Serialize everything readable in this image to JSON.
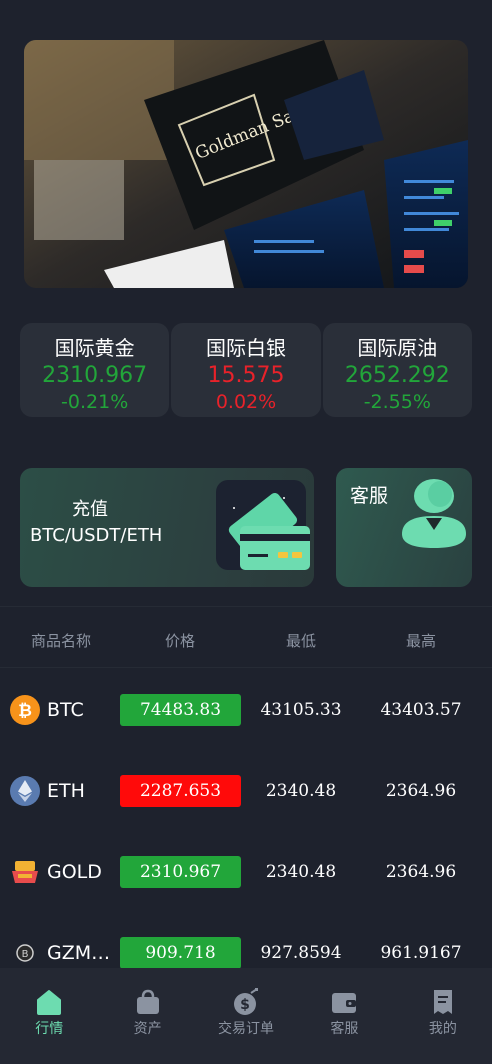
{
  "banner": {
    "sign_text": "Goldman Sachs",
    "alt": "trading floor banner"
  },
  "tickers": [
    {
      "name": "国际黄金",
      "price": "2310.967",
      "change": "-0.21%",
      "price_color": "green",
      "change_color": "green"
    },
    {
      "name": "国际白银",
      "price": "15.575",
      "change": "0.02%",
      "price_color": "red",
      "change_color": "red"
    },
    {
      "name": "国际原油",
      "price": "2652.292",
      "change": "-2.55%",
      "price_color": "green",
      "change_color": "green"
    }
  ],
  "recharge": {
    "title": "充值",
    "subtitle": "BTC/USDT/ETH",
    "icon": "card-icon"
  },
  "service": {
    "title": "客服",
    "icon": "support-agent-icon"
  },
  "table": {
    "headers": [
      "商品名称",
      "价格",
      "最低",
      "最高"
    ],
    "rows": [
      {
        "symbol": "BTC",
        "icon": "bitcoin-icon",
        "price": "74483.83",
        "price_color": "green",
        "low": "43105.33",
        "high": "43403.57"
      },
      {
        "symbol": "ETH",
        "icon": "ethereum-icon",
        "price": "2287.653",
        "price_color": "red",
        "low": "2340.48",
        "high": "2364.96"
      },
      {
        "symbol": "GOLD",
        "icon": "gold-icon",
        "price": "2310.967",
        "price_color": "green",
        "low": "2340.48",
        "high": "2364.96"
      },
      {
        "symbol": "GZMTBTC",
        "icon": "gzm-coin-icon",
        "price": "909.718",
        "price_color": "green",
        "low": "927.8594",
        "high": "961.9167"
      }
    ]
  },
  "tabs": [
    {
      "label": "行情",
      "icon": "home-icon",
      "active": true
    },
    {
      "label": "资产",
      "icon": "bag-icon",
      "active": false
    },
    {
      "label": "交易订单",
      "icon": "dollar-bag-icon",
      "active": false
    },
    {
      "label": "客服",
      "icon": "wallet-icon",
      "active": false
    },
    {
      "label": "我的",
      "icon": "receipt-icon",
      "active": false
    }
  ],
  "colors": {
    "background": "#1e222d",
    "up": "#22a63a",
    "down": "#ff0a0a",
    "accent": "#6ddcb0"
  }
}
